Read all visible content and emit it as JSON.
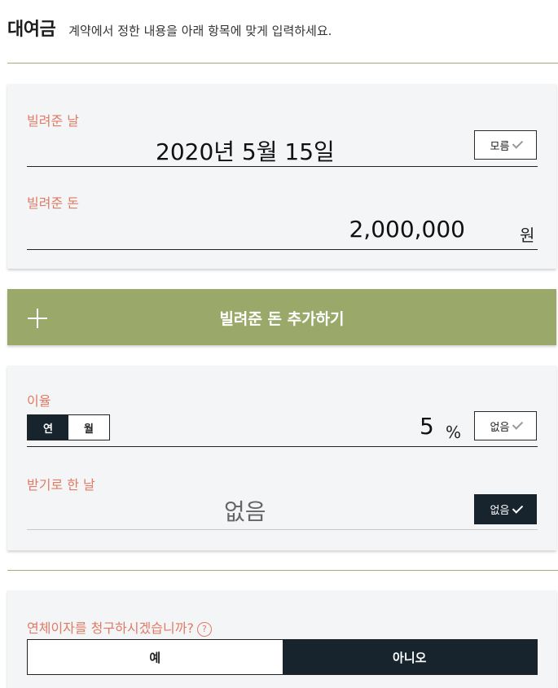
{
  "header": {
    "title": "대여금",
    "subtitle": "계약에서 정한 내용을 아래 항목에 맞게 입력하세요."
  },
  "loan": {
    "date_label": "빌려준 날",
    "date_value": "2020년 5월 15일",
    "unknown_label": "모름",
    "amount_label": "빌려준 돈",
    "amount_value": "2,000,000",
    "amount_unit": "원"
  },
  "add_button_label": "빌려준 돈 추가하기",
  "interest": {
    "label": "이율",
    "toggle": [
      "연",
      "월"
    ],
    "selected": "연",
    "value": "5",
    "unit": "%",
    "none_label": "없음"
  },
  "due": {
    "label": "받기로 한 날",
    "value": "없음",
    "none_label": "없음"
  },
  "overdue": {
    "question": "연체이자를 청구하시겠습니까?",
    "help_icon": "?",
    "yes_label": "예",
    "no_label": "아니오",
    "selected": "아니오"
  },
  "colors": {
    "accent_label": "#e07a63",
    "add_bar": "#9aa96a",
    "dark": "#17232d",
    "divider": "#a7ab7c"
  }
}
